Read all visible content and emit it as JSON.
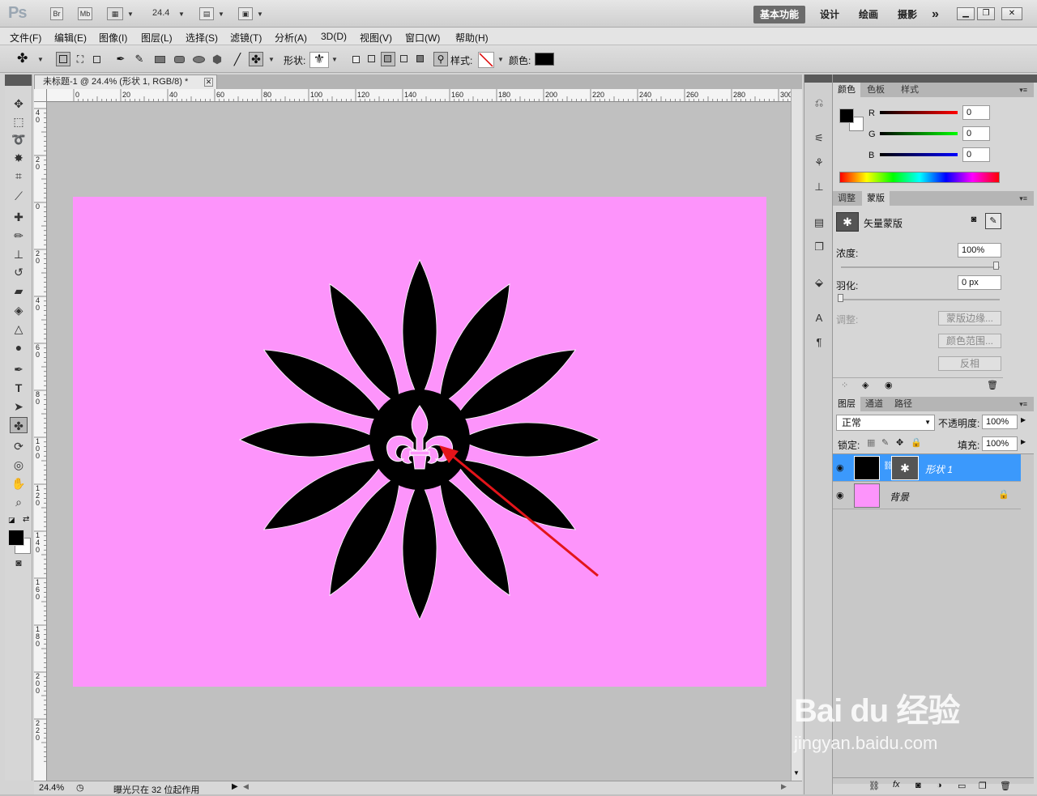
{
  "titlebar": {
    "logo": "Ps",
    "bridge": "Br",
    "minibridge": "Mb",
    "zoom": "24.4",
    "workspaces": [
      "基本功能",
      "设计",
      "绘画",
      "摄影"
    ],
    "more": "»"
  },
  "menu": [
    "文件(F)",
    "编辑(E)",
    "图像(I)",
    "图层(L)",
    "选择(S)",
    "滤镜(T)",
    "分析(A)",
    "3D(D)",
    "视图(V)",
    "窗口(W)",
    "帮助(H)"
  ],
  "options": {
    "shape_label": "形状:",
    "style_label": "样式:",
    "color_label": "颜色:",
    "color_value": "#000000"
  },
  "document": {
    "tab_title": "未标题-1 @ 24.4% (形状 1, RGB/8) *",
    "ruler_top": [
      "0",
      "20",
      "40",
      "60",
      "80",
      "100",
      "120",
      "140",
      "160",
      "180",
      "200",
      "220",
      "240",
      "260",
      "280",
      "300"
    ],
    "ruler_left": [
      "4 0",
      "2 0",
      "0",
      "2 0",
      "4 0",
      "6 0",
      "8 0",
      "1 0 0",
      "1 2 0",
      "1 4 0",
      "1 6 0",
      "1 8 0",
      "2 0 0",
      "2 2 0"
    ],
    "canvas_color": "#fd94fb",
    "status_zoom": "24.4%",
    "status_text": "曝光只在 32 位起作用"
  },
  "color_panel": {
    "tabs": [
      "颜色",
      "色板",
      "样式"
    ],
    "r_label": "R",
    "g_label": "G",
    "b_label": "B",
    "r_value": "0",
    "g_value": "0",
    "b_value": "0"
  },
  "mask_panel": {
    "tabs": [
      "调整",
      "蒙版"
    ],
    "title": "矢量蒙版",
    "density_label": "浓度:",
    "density_value": "100%",
    "feather_label": "羽化:",
    "feather_value": "0 px",
    "refine_label": "调整:",
    "mask_edge_button": "蒙版边缘...",
    "color_range_button": "颜色范围...",
    "invert_button": "反相"
  },
  "layers_panel": {
    "tabs": [
      "图层",
      "通道",
      "路径"
    ],
    "blend_mode": "正常",
    "opacity_label": "不透明度:",
    "opacity_value": "100%",
    "lock_label": "锁定:",
    "fill_label": "填充:",
    "fill_value": "100%",
    "layers": [
      {
        "name": "形状 1",
        "selected": true
      },
      {
        "name": "背景",
        "selected": false
      }
    ]
  },
  "watermark": {
    "brand": "Bai du 经验",
    "url": "jingyan.baidu.com"
  }
}
